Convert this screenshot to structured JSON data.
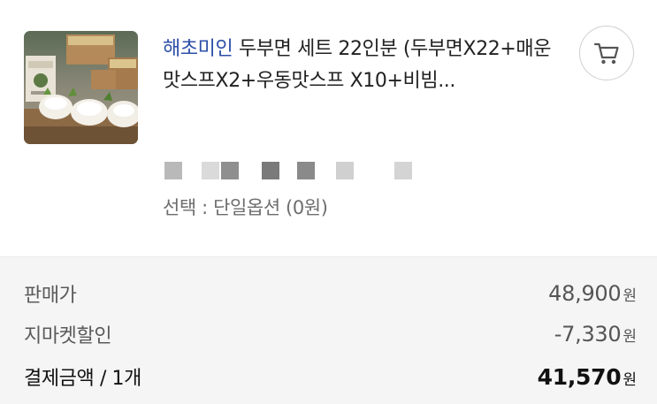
{
  "product": {
    "seller": "해초미인",
    "title": "해초미인 두부면 세트 22인분 (두부면X22+매운맛스프X2+우동맛스프 X10+비빔...",
    "option_text": "선택 : 단일옵션 (0원)",
    "image_icon": "product-photo-tofu-noodles",
    "cart_icon": "shopping-cart-icon"
  },
  "summary": {
    "sale_price_label": "판매가",
    "sale_price_value": "48,900",
    "discount_label": "지마켓할인",
    "discount_value": "-7,330",
    "total_label": "결제금액 / 1개",
    "total_value": "41,570",
    "currency": "원"
  },
  "colors": {
    "brand_link": "#2d4fa8",
    "summary_bg": "#f5f5f5",
    "text_main": "#222222",
    "text_sub": "#6d6d6d"
  }
}
